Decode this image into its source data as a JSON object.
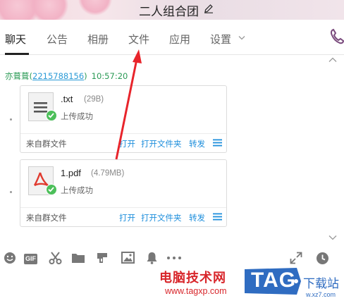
{
  "header": {
    "group_name": "二人组合团"
  },
  "tabs": [
    {
      "label": "聊天",
      "active": true
    },
    {
      "label": "公告"
    },
    {
      "label": "相册"
    },
    {
      "label": "文件"
    },
    {
      "label": "应用"
    },
    {
      "label": "设置"
    }
  ],
  "chat": {
    "sender_name": "亦葺葺",
    "sender_id_open": "(",
    "sender_id": "2215788156",
    "sender_id_close": ")",
    "time": "10:57:20",
    "files": [
      {
        "name": ".txt",
        "size": "(29B)",
        "status": "上传成功",
        "source": "来自群文件",
        "actions": {
          "open": "打开",
          "open_folder": "打开文件夹",
          "forward": "转发"
        },
        "icon": "text-file-icon"
      },
      {
        "name": "1.pdf",
        "size": "(4.79MB)",
        "status": "上传成功",
        "source": "来自群文件",
        "actions": {
          "open": "打开",
          "open_folder": "打开文件夹",
          "forward": "转发"
        },
        "icon": "pdf-file-icon"
      }
    ]
  },
  "toolbar": {
    "gif_label": "GIF"
  },
  "watermark": {
    "site_name": "电脑技术网",
    "site_url": "www.tagxp.com",
    "logo_text": "TAG",
    "side_text": "下载站",
    "side_url": "w.xz7.com"
  },
  "colors": {
    "accent_link": "#1f8fdc",
    "success": "#4cbf5a",
    "sender": "#2a9a55",
    "watermark_red": "#d8262b",
    "logo_blue": "#2f6cc1"
  }
}
